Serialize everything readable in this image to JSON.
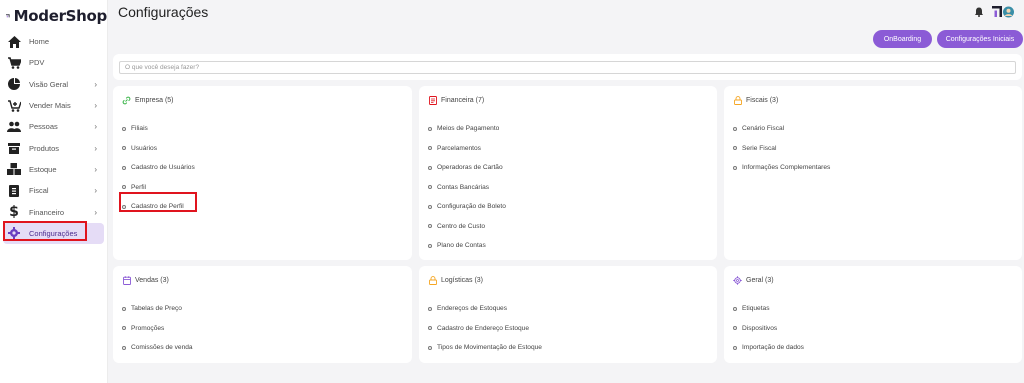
{
  "app": {
    "logo_text": "ModerShop"
  },
  "header": {
    "title": "Configurações"
  },
  "actions": {
    "onboarding_label": "OnBoarding",
    "initial_config_label": "Configurações Iniciais"
  },
  "search": {
    "placeholder": "O que você deseja fazer?"
  },
  "sidebar": {
    "items": [
      {
        "label": "Home",
        "icon": "home-icon",
        "has_children": false
      },
      {
        "label": "PDV",
        "icon": "cart-icon",
        "has_children": false
      },
      {
        "label": "Visão Geral",
        "icon": "pie-chart-icon",
        "has_children": true
      },
      {
        "label": "Vender Mais",
        "icon": "cart-plus-icon",
        "has_children": true
      },
      {
        "label": "Pessoas",
        "icon": "people-icon",
        "has_children": true
      },
      {
        "label": "Produtos",
        "icon": "box-icon",
        "has_children": true
      },
      {
        "label": "Estoque",
        "icon": "boxes-icon",
        "has_children": true
      },
      {
        "label": "Fiscal",
        "icon": "document-icon",
        "has_children": true
      },
      {
        "label": "Financeiro",
        "icon": "dollar-icon",
        "has_children": true
      },
      {
        "label": "Configurações",
        "icon": "gear-icon",
        "has_children": false,
        "active": true
      }
    ]
  },
  "cards": {
    "empresa": {
      "title": "Empresa (5)",
      "icon": "link-icon",
      "items": [
        "Filiais",
        "Usuários",
        "Cadastro de Usuários",
        "Perfil",
        "Cadastro de Perfil"
      ]
    },
    "financeira": {
      "title": "Financeira (7)",
      "icon": "invoice-icon",
      "items": [
        "Meios de Pagamento",
        "Parcelamentos",
        "Operadoras de Cartão",
        "Contas Bancárias",
        "Configuração de Boleto",
        "Centro de Custo",
        "Plano de Contas"
      ]
    },
    "fiscais": {
      "title": "Fiscais (3)",
      "icon": "lock-icon",
      "items": [
        "Cenário Fiscal",
        "Serie Fiscal",
        "Informações Complementares"
      ]
    },
    "vendas": {
      "title": "Vendas (3)",
      "icon": "calendar-icon",
      "items": [
        "Tabelas de Preço",
        "Promoções",
        "Comissões de venda"
      ]
    },
    "logisticas": {
      "title": "Logísticas (3)",
      "icon": "lock-icon",
      "items": [
        "Endereços de Estoques",
        "Cadastro de Endereço Estoque",
        "Tipos de Movimentação de Estoque"
      ]
    },
    "geral": {
      "title": "Geral (3)",
      "icon": "gear-icon",
      "items": [
        "Etiquetas",
        "Dispositivos",
        "Importação de dados"
      ]
    }
  },
  "colors": {
    "accent": "#8b5bd6",
    "active_bg": "#e5dcf6",
    "highlight": "#e0141e"
  }
}
